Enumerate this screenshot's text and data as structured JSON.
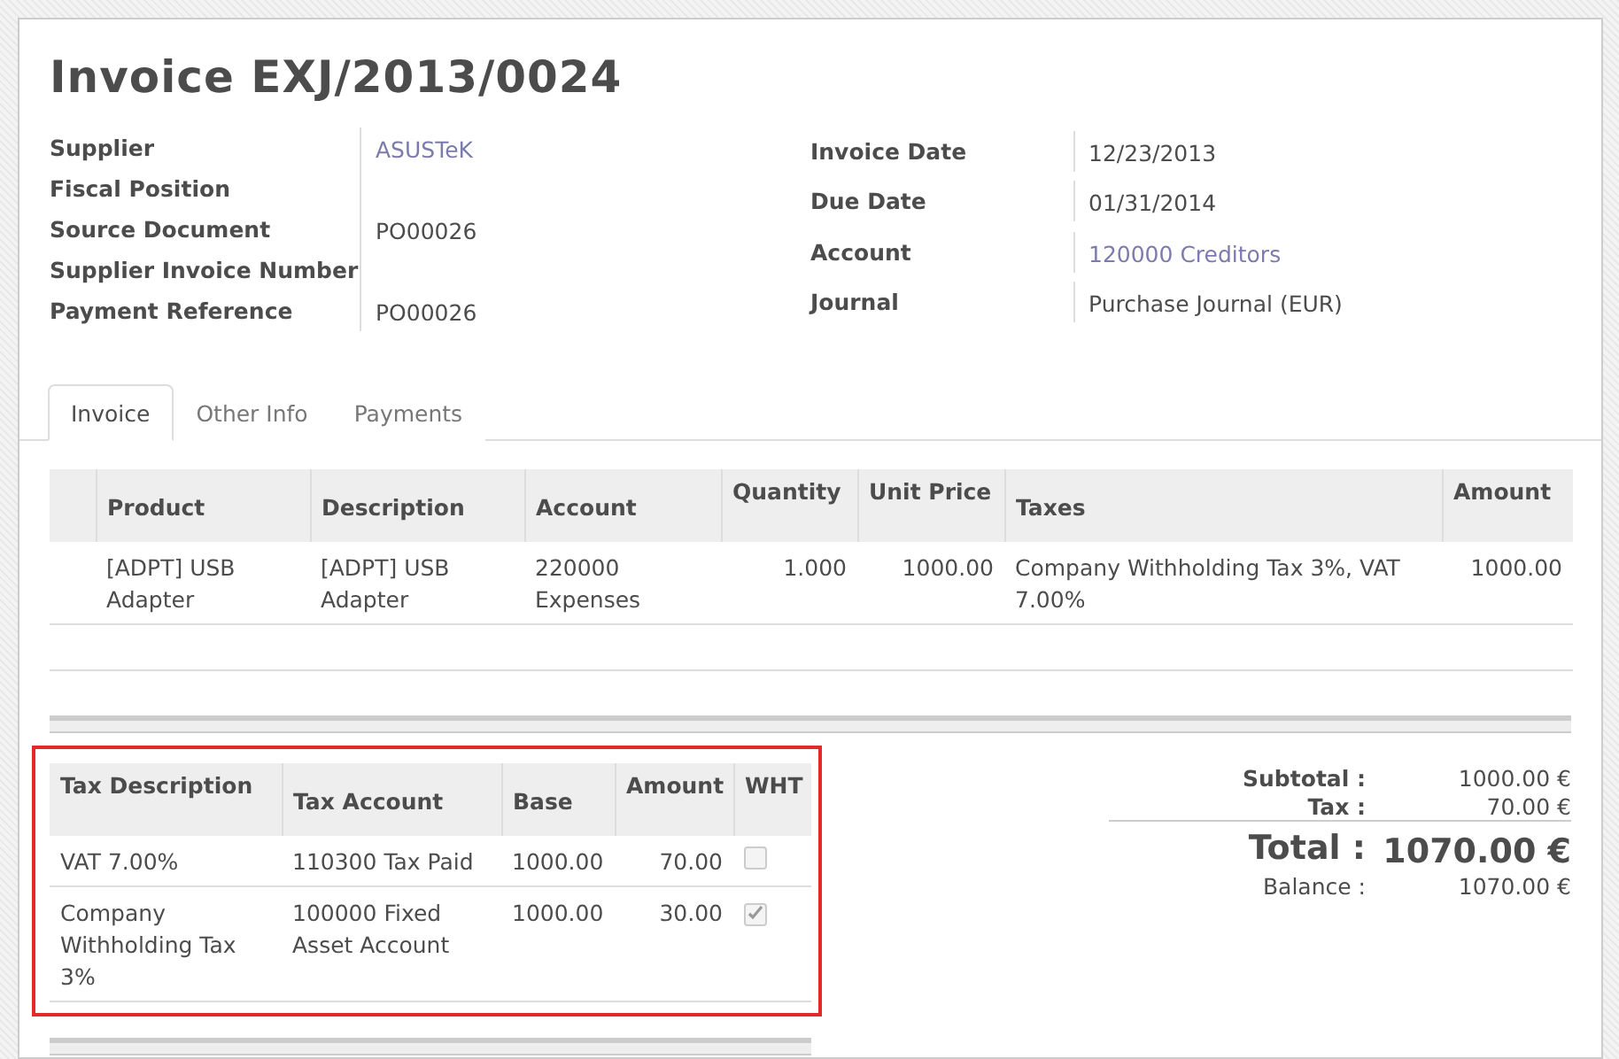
{
  "title": "Invoice EXJ/2013/0024",
  "left_fields": [
    {
      "label": "Supplier",
      "value": "ASUSTeK",
      "kind": "link"
    },
    {
      "label": "Fiscal Position",
      "kind": "empty"
    },
    {
      "label": "Source Document",
      "value": "PO00026",
      "kind": "text"
    },
    {
      "label": "Supplier Invoice Number",
      "kind": "empty"
    },
    {
      "label": "Payment Reference",
      "value": "PO00026",
      "kind": "text"
    }
  ],
  "right_fields": [
    {
      "label": "Invoice Date",
      "value": "12/23/2013",
      "kind": "text"
    },
    {
      "label": "Due Date",
      "value": "01/31/2014",
      "kind": "text"
    },
    {
      "label": "Account",
      "value": "120000 Creditors",
      "kind": "link"
    },
    {
      "label": "Journal",
      "value": "Purchase Journal (EUR)",
      "kind": "text"
    }
  ],
  "tabs": [
    {
      "label": "Invoice",
      "selected": true
    },
    {
      "label": "Other Info",
      "selected": false
    },
    {
      "label": "Payments",
      "selected": false
    }
  ],
  "invoice_lines": {
    "columns": [
      "Product",
      "Description",
      "Account",
      "Quantity",
      "Unit Price",
      "Taxes",
      "Amount"
    ],
    "rows": [
      {
        "cells": [
          "[ADPT] USB Adapter",
          "[ADPT] USB Adapter",
          "220000 Expenses",
          "1.000",
          "1000.00",
          "Company Withholding Tax 3%, VAT 7.00%",
          "1000.00"
        ]
      }
    ]
  },
  "tax_lines": {
    "columns": [
      "Tax Description",
      "Tax Account",
      "Base",
      "Amount",
      "WHT"
    ],
    "rows": [
      {
        "cells": [
          "VAT 7.00%",
          "110300 Tax Paid",
          "1000.00",
          "70.00"
        ],
        "wht": false
      },
      {
        "cells": [
          "Company Withholding Tax 3%",
          "100000 Fixed Asset Account",
          "1000.00",
          "30.00"
        ],
        "wht": true
      }
    ]
  },
  "totals": [
    {
      "label": "Subtotal :",
      "value": "1000.00 €",
      "kind": "sub"
    },
    {
      "label": "Tax :",
      "value": "70.00 €",
      "kind": "sub"
    },
    {
      "label": "Total :",
      "value": "1070.00 €",
      "kind": "grand"
    },
    {
      "label": "Balance :",
      "value": "1070.00 €",
      "kind": "plain"
    }
  ]
}
